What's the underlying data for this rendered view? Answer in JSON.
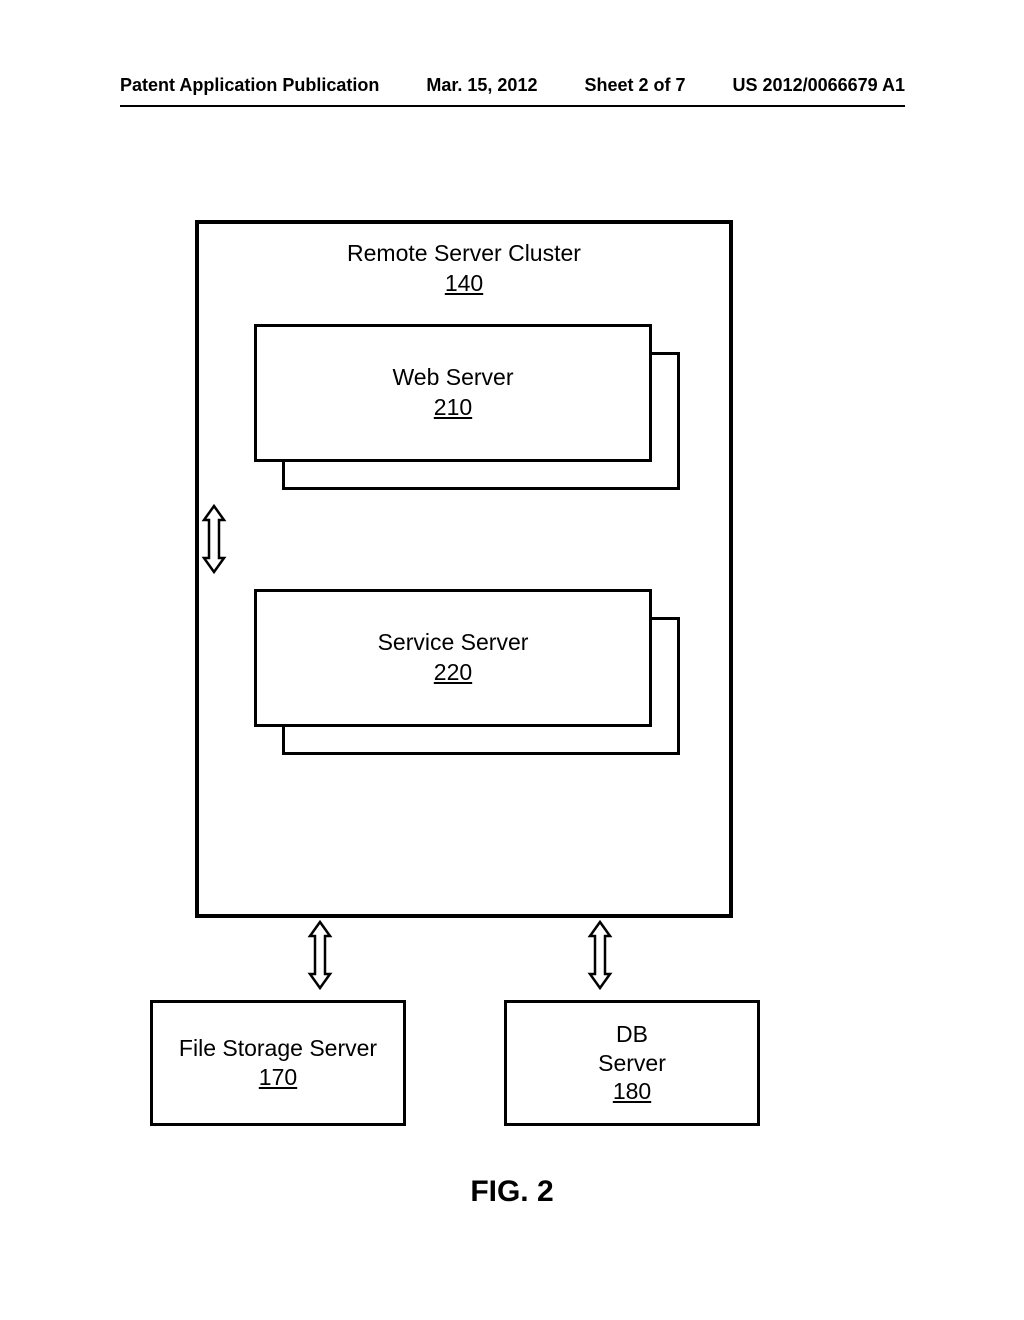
{
  "header": {
    "pub_type": "Patent Application Publication",
    "date": "Mar. 15, 2012",
    "sheet": "Sheet 2 of 7",
    "pub_number": "US 2012/0066679 A1"
  },
  "diagram": {
    "cluster": {
      "title": "Remote Server Cluster",
      "ref": "140"
    },
    "web_server": {
      "title": "Web Server",
      "ref": "210"
    },
    "service_server": {
      "title": "Service Server",
      "ref": "220"
    },
    "file_storage": {
      "title": "File Storage Server",
      "ref": "170"
    },
    "db_server": {
      "title_line1": "DB",
      "title_line2": "Server",
      "ref": "180"
    }
  },
  "figure_label": "FIG. 2"
}
